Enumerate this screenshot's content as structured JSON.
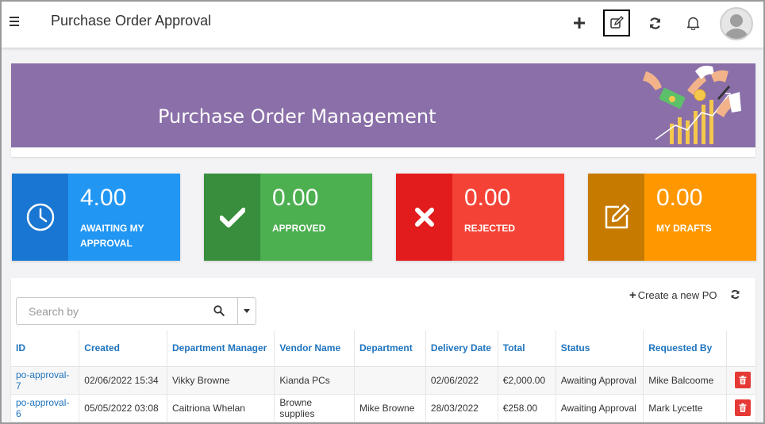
{
  "header": {
    "title": "Purchase Order Approval",
    "icons": [
      "menu-icon",
      "plus-icon",
      "edit-icon",
      "refresh-icon",
      "bell-icon",
      "user-avatar"
    ]
  },
  "banner": {
    "title": "Purchase Order Management",
    "color": "#8a6fa8"
  },
  "stats": [
    {
      "value": "4.00",
      "label": "AWAITING MY APPROVAL",
      "icon": "clock-icon",
      "dark": "#1976d2",
      "light": "#2196f3"
    },
    {
      "value": "0.00",
      "label": "APPROVED",
      "icon": "check-icon",
      "dark": "#388e3c",
      "light": "#4caf50"
    },
    {
      "value": "0.00",
      "label": "REJECTED",
      "icon": "x-icon",
      "dark": "#e21c1c",
      "light": "#f44336"
    },
    {
      "value": "0.00",
      "label": "MY DRAFTS",
      "icon": "edit-square-icon",
      "dark": "#c77a00",
      "light": "#ff9800"
    }
  ],
  "search": {
    "placeholder": "Search by"
  },
  "actions": {
    "create_label": "Create a new PO"
  },
  "table": {
    "columns": [
      "ID",
      "Created",
      "Department Manager",
      "Vendor Name",
      "Department",
      "Delivery Date",
      "Total",
      "Status",
      "Requested By",
      ""
    ],
    "rows": [
      [
        "po-approval-7",
        "02/06/2022 15:34",
        "Vikky Browne",
        "Kianda PCs",
        "",
        "02/06/2022",
        "€2,000.00",
        "Awaiting Approval",
        "Mike Balcoome"
      ],
      [
        "po-approval-6",
        "05/05/2022 03:08",
        "Caitriona Whelan",
        "Browne supplies",
        "Mike Browne",
        "28/03/2022",
        "€258.00",
        "Awaiting Approval",
        "Mark Lycette"
      ]
    ]
  }
}
